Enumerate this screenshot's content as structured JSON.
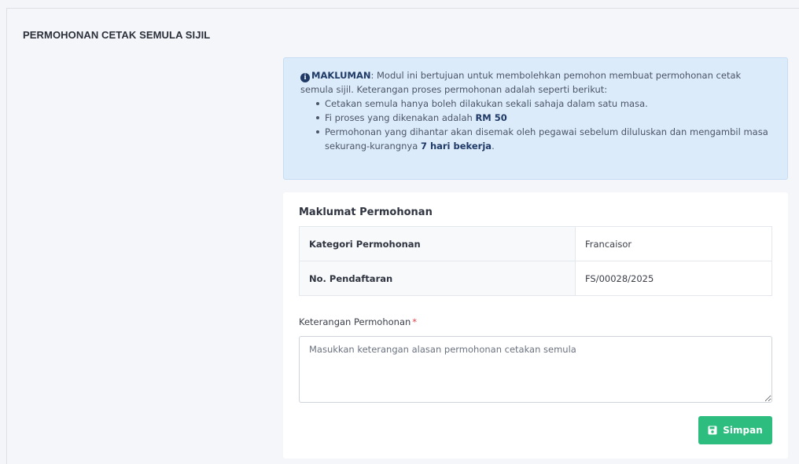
{
  "page": {
    "title": "PERMOHONAN CETAK SEMULA SIJIL"
  },
  "notice": {
    "icon": "info-circle-icon",
    "label": "MAKLUMAN",
    "intro": ": Modul ini bertujuan untuk membolehkan pemohon membuat permohonan cetak semula sijil. Keterangan proses permohonan adalah seperti berikut:",
    "bullet1": "Cetakan semula hanya boleh dilakukan sekali sahaja dalam satu masa.",
    "bullet2_prefix": "Fi proses yang dikenakan adalah ",
    "bullet2_strong": "RM 50",
    "bullet3_prefix": "Permohonan yang dihantar akan disemak oleh pegawai sebelum diluluskan dan mengambil masa sekurang-kurangnya ",
    "bullet3_strong": "7 hari bekerja",
    "bullet3_suffix": "."
  },
  "details": {
    "section_title": "Maklumat Permohonan",
    "rows": [
      {
        "label": "Kategori Permohonan",
        "value": "Francaisor"
      },
      {
        "label": "No. Pendaftaran",
        "value": "FS/00028/2025"
      }
    ]
  },
  "form": {
    "remark_label": "Keterangan Permohonan",
    "required_mark": "*",
    "remark_value": "",
    "remark_placeholder": "Masukkan keterangan alasan permohonan cetakan semula",
    "save_label": "Simpan",
    "save_icon": "floppy-disk-icon"
  },
  "colors": {
    "primary_text": "#1f3a66",
    "alert_bg": "#dcebfa",
    "success": "#2dbd7e",
    "required": "#e0434b"
  }
}
